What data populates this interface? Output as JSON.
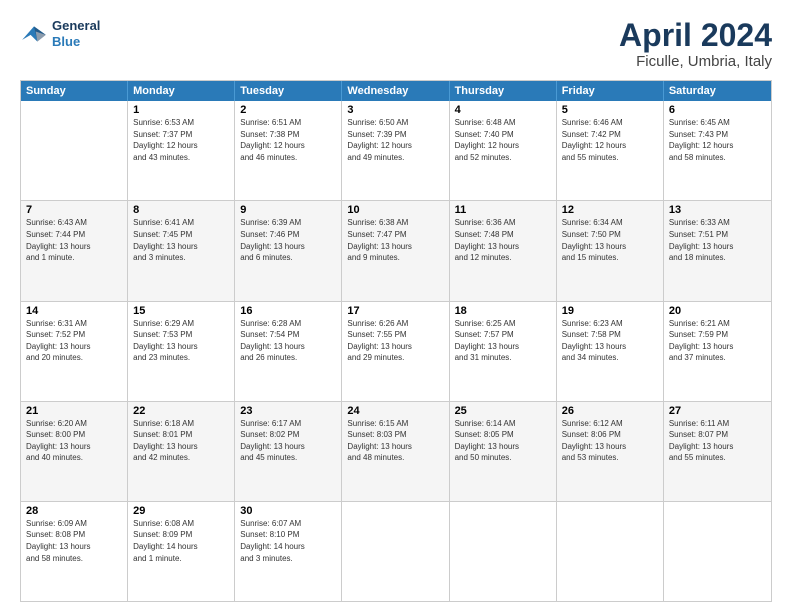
{
  "logo": {
    "line1": "General",
    "line2": "Blue"
  },
  "title": "April 2024",
  "subtitle": "Ficulle, Umbria, Italy",
  "days_of_week": [
    "Sunday",
    "Monday",
    "Tuesday",
    "Wednesday",
    "Thursday",
    "Friday",
    "Saturday"
  ],
  "weeks": [
    [
      {
        "day": "",
        "info": ""
      },
      {
        "day": "1",
        "info": "Sunrise: 6:53 AM\nSunset: 7:37 PM\nDaylight: 12 hours\nand 43 minutes."
      },
      {
        "day": "2",
        "info": "Sunrise: 6:51 AM\nSunset: 7:38 PM\nDaylight: 12 hours\nand 46 minutes."
      },
      {
        "day": "3",
        "info": "Sunrise: 6:50 AM\nSunset: 7:39 PM\nDaylight: 12 hours\nand 49 minutes."
      },
      {
        "day": "4",
        "info": "Sunrise: 6:48 AM\nSunset: 7:40 PM\nDaylight: 12 hours\nand 52 minutes."
      },
      {
        "day": "5",
        "info": "Sunrise: 6:46 AM\nSunset: 7:42 PM\nDaylight: 12 hours\nand 55 minutes."
      },
      {
        "day": "6",
        "info": "Sunrise: 6:45 AM\nSunset: 7:43 PM\nDaylight: 12 hours\nand 58 minutes."
      }
    ],
    [
      {
        "day": "7",
        "info": "Sunrise: 6:43 AM\nSunset: 7:44 PM\nDaylight: 13 hours\nand 1 minute."
      },
      {
        "day": "8",
        "info": "Sunrise: 6:41 AM\nSunset: 7:45 PM\nDaylight: 13 hours\nand 3 minutes."
      },
      {
        "day": "9",
        "info": "Sunrise: 6:39 AM\nSunset: 7:46 PM\nDaylight: 13 hours\nand 6 minutes."
      },
      {
        "day": "10",
        "info": "Sunrise: 6:38 AM\nSunset: 7:47 PM\nDaylight: 13 hours\nand 9 minutes."
      },
      {
        "day": "11",
        "info": "Sunrise: 6:36 AM\nSunset: 7:48 PM\nDaylight: 13 hours\nand 12 minutes."
      },
      {
        "day": "12",
        "info": "Sunrise: 6:34 AM\nSunset: 7:50 PM\nDaylight: 13 hours\nand 15 minutes."
      },
      {
        "day": "13",
        "info": "Sunrise: 6:33 AM\nSunset: 7:51 PM\nDaylight: 13 hours\nand 18 minutes."
      }
    ],
    [
      {
        "day": "14",
        "info": "Sunrise: 6:31 AM\nSunset: 7:52 PM\nDaylight: 13 hours\nand 20 minutes."
      },
      {
        "day": "15",
        "info": "Sunrise: 6:29 AM\nSunset: 7:53 PM\nDaylight: 13 hours\nand 23 minutes."
      },
      {
        "day": "16",
        "info": "Sunrise: 6:28 AM\nSunset: 7:54 PM\nDaylight: 13 hours\nand 26 minutes."
      },
      {
        "day": "17",
        "info": "Sunrise: 6:26 AM\nSunset: 7:55 PM\nDaylight: 13 hours\nand 29 minutes."
      },
      {
        "day": "18",
        "info": "Sunrise: 6:25 AM\nSunset: 7:57 PM\nDaylight: 13 hours\nand 31 minutes."
      },
      {
        "day": "19",
        "info": "Sunrise: 6:23 AM\nSunset: 7:58 PM\nDaylight: 13 hours\nand 34 minutes."
      },
      {
        "day": "20",
        "info": "Sunrise: 6:21 AM\nSunset: 7:59 PM\nDaylight: 13 hours\nand 37 minutes."
      }
    ],
    [
      {
        "day": "21",
        "info": "Sunrise: 6:20 AM\nSunset: 8:00 PM\nDaylight: 13 hours\nand 40 minutes."
      },
      {
        "day": "22",
        "info": "Sunrise: 6:18 AM\nSunset: 8:01 PM\nDaylight: 13 hours\nand 42 minutes."
      },
      {
        "day": "23",
        "info": "Sunrise: 6:17 AM\nSunset: 8:02 PM\nDaylight: 13 hours\nand 45 minutes."
      },
      {
        "day": "24",
        "info": "Sunrise: 6:15 AM\nSunset: 8:03 PM\nDaylight: 13 hours\nand 48 minutes."
      },
      {
        "day": "25",
        "info": "Sunrise: 6:14 AM\nSunset: 8:05 PM\nDaylight: 13 hours\nand 50 minutes."
      },
      {
        "day": "26",
        "info": "Sunrise: 6:12 AM\nSunset: 8:06 PM\nDaylight: 13 hours\nand 53 minutes."
      },
      {
        "day": "27",
        "info": "Sunrise: 6:11 AM\nSunset: 8:07 PM\nDaylight: 13 hours\nand 55 minutes."
      }
    ],
    [
      {
        "day": "28",
        "info": "Sunrise: 6:09 AM\nSunset: 8:08 PM\nDaylight: 13 hours\nand 58 minutes."
      },
      {
        "day": "29",
        "info": "Sunrise: 6:08 AM\nSunset: 8:09 PM\nDaylight: 14 hours\nand 1 minute."
      },
      {
        "day": "30",
        "info": "Sunrise: 6:07 AM\nSunset: 8:10 PM\nDaylight: 14 hours\nand 3 minutes."
      },
      {
        "day": "",
        "info": ""
      },
      {
        "day": "",
        "info": ""
      },
      {
        "day": "",
        "info": ""
      },
      {
        "day": "",
        "info": ""
      }
    ]
  ]
}
